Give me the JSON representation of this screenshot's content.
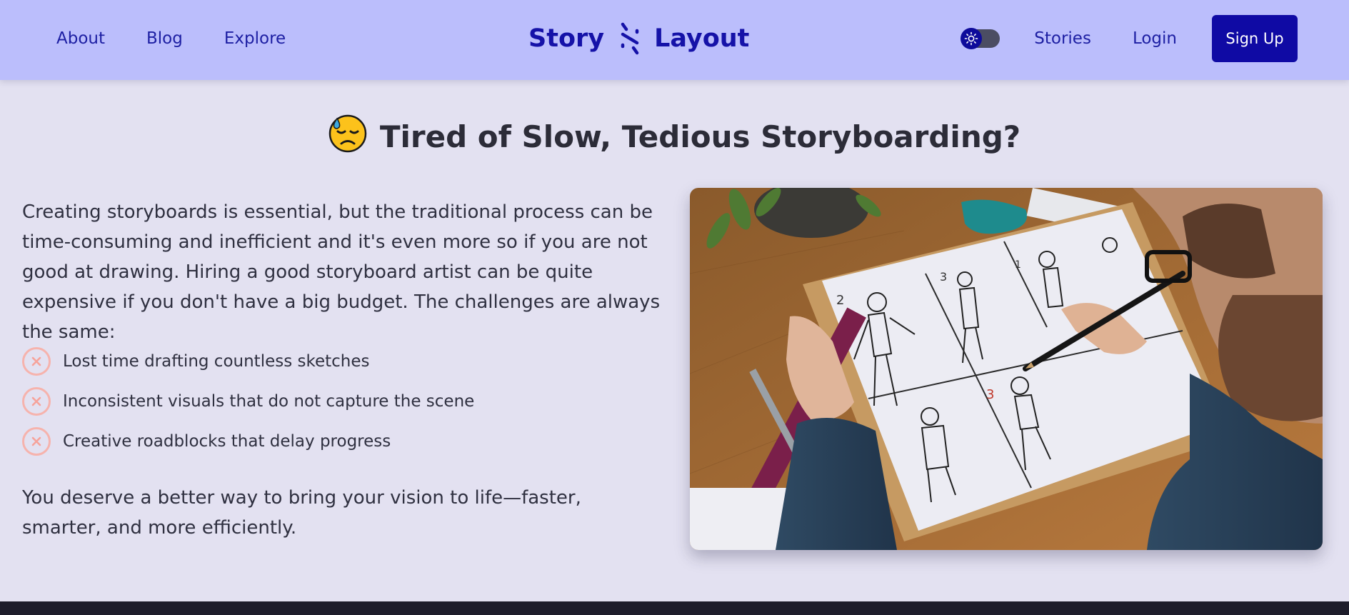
{
  "nav": {
    "left_links": [
      {
        "label": "About"
      },
      {
        "label": "Blog"
      },
      {
        "label": "Explore"
      }
    ],
    "logo": {
      "word1": "Story",
      "word2": "Layout"
    },
    "theme_toggle_icon": "sun-icon",
    "right_links": [
      {
        "label": "Stories"
      },
      {
        "label": "Login"
      }
    ],
    "signup_label": "Sign Up"
  },
  "headline": {
    "emoji_icon": "downcast-face-with-sweat-emoji",
    "text": "Tired of Slow, Tedious Storyboarding?"
  },
  "intro": "Creating storyboards is essential, but the traditional process can be time-consuming and inefficient and it's even more so if you are not good at drawing. Hiring a good storyboard artist can be quite expensive if you don't have a big budget. The challenges are always the same:",
  "challenges": [
    {
      "icon": "x-circle-icon",
      "text": "Lost time drafting countless sketches"
    },
    {
      "icon": "x-circle-icon",
      "text": "Inconsistent visuals that do not capture the scene"
    },
    {
      "icon": "x-circle-icon",
      "text": "Creative roadblocks that delay progress"
    }
  ],
  "outro": "You deserve a better way to bring your vision to life—faster, smarter, and more efficiently.",
  "hero_image": {
    "icon": "storyboard-sketching-photo",
    "panel_numbers": [
      "2",
      "3",
      "1",
      "3"
    ]
  },
  "colors": {
    "page_bg": "#e3e1f1",
    "nav_bg": "#bbbefc",
    "accent": "#0f0aa4",
    "x_icon": "#f6b3ad",
    "footer": "#1e1d2b"
  }
}
